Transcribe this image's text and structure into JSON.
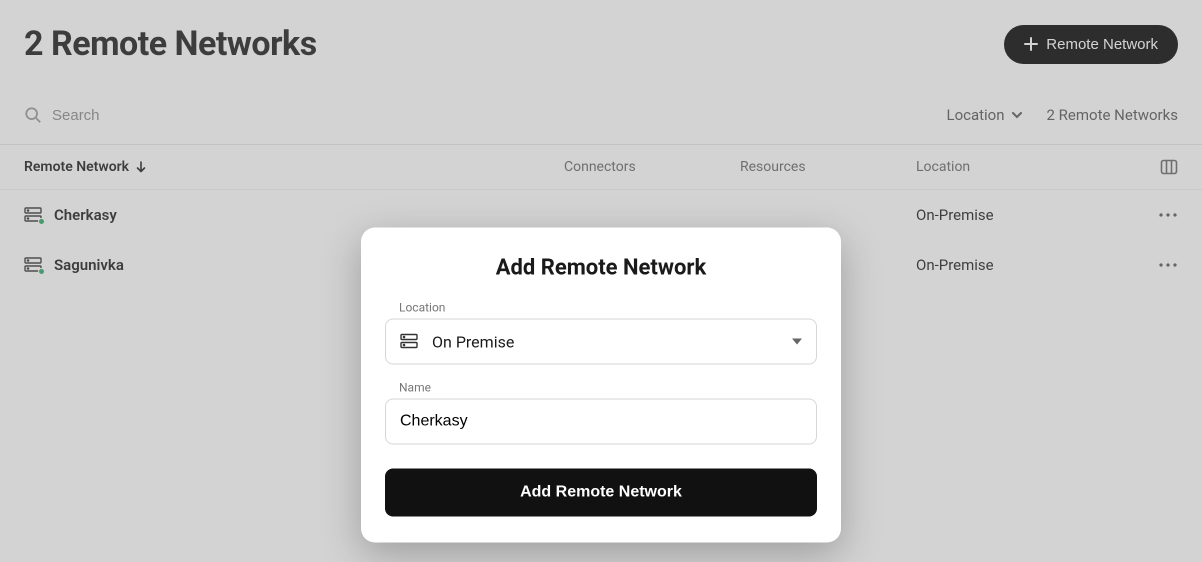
{
  "header": {
    "title": "2 Remote Networks",
    "add_button": "Remote Network"
  },
  "toolbar": {
    "search_placeholder": "Search",
    "location_filter": "Location",
    "count_label": "2 Remote Networks"
  },
  "columns": {
    "name": "Remote Network",
    "connectors": "Connectors",
    "resources": "Resources",
    "location": "Location"
  },
  "rows": [
    {
      "name": "Cherkasy",
      "location": "On-Premise"
    },
    {
      "name": "Sagunivka",
      "location": "On-Premise"
    }
  ],
  "modal": {
    "title": "Add Remote Network",
    "location_label": "Location",
    "location_value": "On Premise",
    "name_label": "Name",
    "name_value": "Cherkasy",
    "submit": "Add Remote Network"
  }
}
